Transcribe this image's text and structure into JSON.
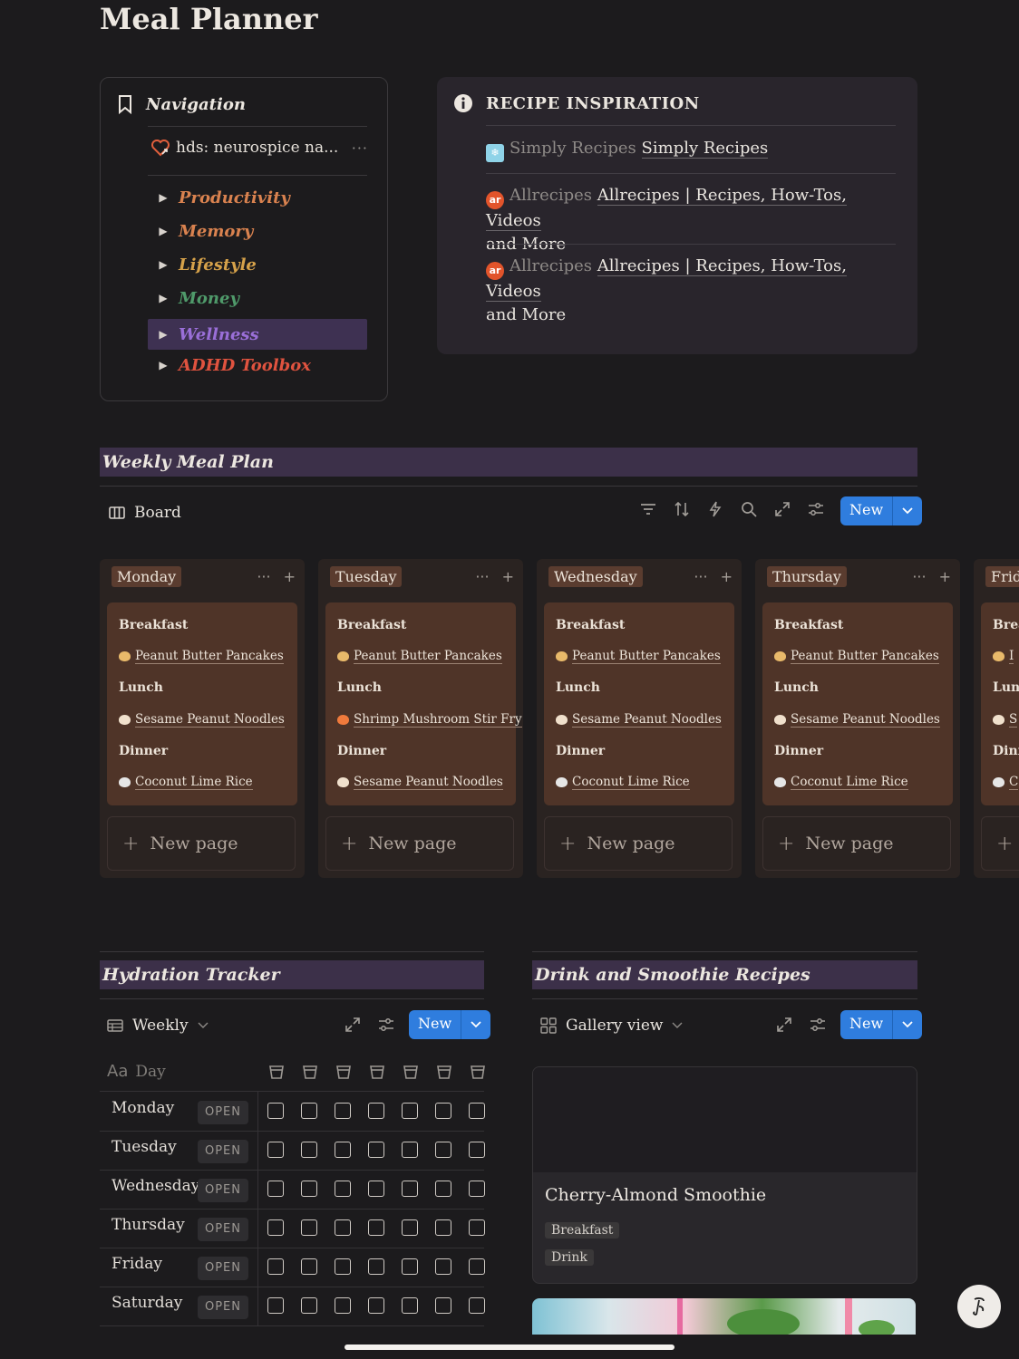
{
  "page": {
    "title": "Meal Planner"
  },
  "navigation": {
    "heading": "Navigation",
    "link_label": "hds: neurospice na...",
    "items": [
      {
        "label": "Productivity",
        "color": "#d9824f"
      },
      {
        "label": "Memory",
        "color": "#d9824f"
      },
      {
        "label": "Lifestyle",
        "color": "#d6a24a"
      },
      {
        "label": "Money",
        "color": "#4f9a6a"
      },
      {
        "label": "Wellness",
        "color": "#9a6fd8"
      },
      {
        "label": "ADHD Toolbox",
        "color": "#e0533f"
      }
    ]
  },
  "inspiration": {
    "heading": "RECIPE INSPIRATION",
    "items": [
      {
        "site": "Simply Recipes",
        "title": "Simply Recipes",
        "more": "",
        "favicon": "snowflake-icon"
      },
      {
        "site": "Allrecipes",
        "title": "Allrecipes | Recipes, How-Tos, Videos",
        "more": "and More",
        "favicon_text": "ar"
      },
      {
        "site": "Allrecipes",
        "title": "Allrecipes | Recipes, How-Tos, Videos",
        "more": "and More",
        "favicon_text": "ar"
      }
    ]
  },
  "weekly": {
    "heading": "Weekly Meal Plan",
    "view_label": "Board",
    "new_label": "New",
    "new_page_label": "New page",
    "columns": [
      {
        "day": "Monday",
        "sections": [
          "Breakfast",
          "Lunch",
          "Dinner"
        ],
        "dishes": [
          "Peanut Butter Pancakes",
          "Sesame Peanut Noodles",
          "Coconut Lime Rice"
        ]
      },
      {
        "day": "Tuesday",
        "sections": [
          "Breakfast",
          "Lunch",
          "Dinner"
        ],
        "dishes": [
          "Peanut Butter Pancakes",
          "Shrimp Mushroom Stir Fry",
          "Sesame Peanut Noodles"
        ]
      },
      {
        "day": "Wednesday",
        "sections": [
          "Breakfast",
          "Lunch",
          "Dinner"
        ],
        "dishes": [
          "Peanut Butter Pancakes",
          "Sesame Peanut Noodles",
          "Coconut Lime Rice"
        ]
      },
      {
        "day": "Thursday",
        "sections": [
          "Breakfast",
          "Lunch",
          "Dinner"
        ],
        "dishes": [
          "Peanut Butter Pancakes",
          "Sesame Peanut Noodles",
          "Coconut Lime Rice"
        ]
      },
      {
        "day": "Frid",
        "sections": [
          "Brea",
          "Lun",
          "Dinn"
        ],
        "dishes": [
          "I",
          "S",
          "C"
        ]
      }
    ]
  },
  "hydration": {
    "heading": "Hydration Tracker",
    "view_label": "Weekly",
    "new_label": "New",
    "column_header": "Day",
    "open_label": "OPEN",
    "days": [
      "Monday",
      "Tuesday",
      "Wednesday",
      "Thursday",
      "Friday",
      "Saturday"
    ]
  },
  "drinks": {
    "heading": "Drink and Smoothie Recipes",
    "view_label": "Gallery view",
    "new_label": "New",
    "card": {
      "name": "Cherry-Almond Smoothie",
      "tags": [
        "Breakfast",
        "Drink"
      ]
    }
  }
}
